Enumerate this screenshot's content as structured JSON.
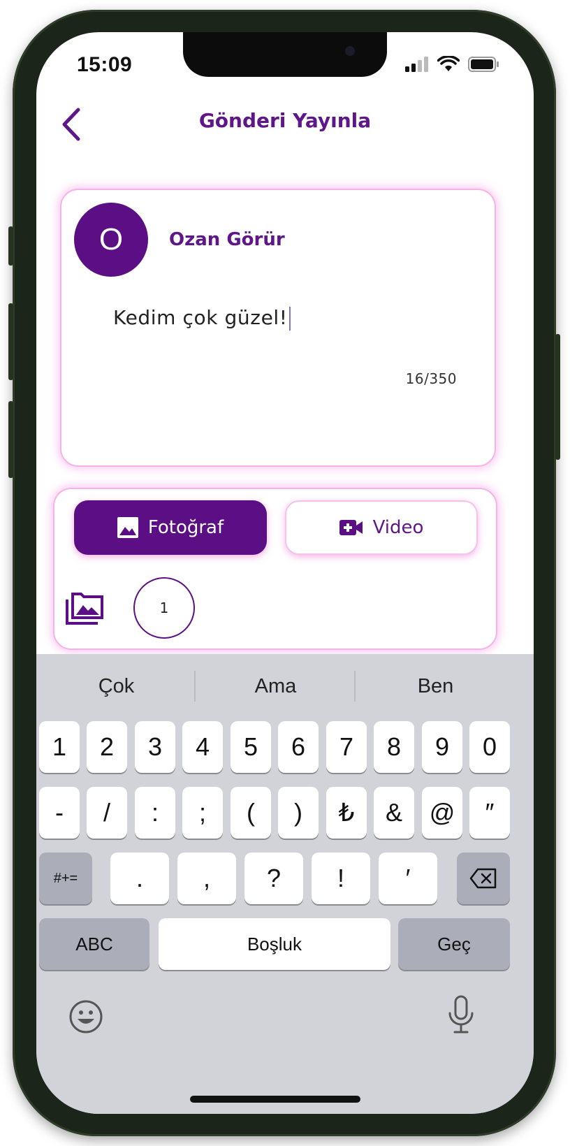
{
  "status_bar": {
    "time": "15:09"
  },
  "header": {
    "title": "Gönderi Yayınla"
  },
  "composer": {
    "avatar_initial": "O",
    "user_name": "Ozan Görür",
    "text": "Kedim çok güzel!",
    "char_counter": "16/350"
  },
  "media": {
    "tabs": [
      {
        "label": "Fotoğraf",
        "selected": true
      },
      {
        "label": "Video",
        "selected": false
      }
    ],
    "selected_count": "1"
  },
  "keyboard": {
    "suggestions": [
      "Çok",
      "Ama",
      "Ben"
    ],
    "row1": [
      "1",
      "2",
      "3",
      "4",
      "5",
      "6",
      "7",
      "8",
      "9",
      "0"
    ],
    "row2": [
      "-",
      "/",
      ":",
      ";",
      "(",
      ")",
      "₺",
      "&",
      "@",
      "″"
    ],
    "row3": [
      "#+=",
      ".",
      ",",
      "?",
      "!",
      "′"
    ],
    "abc_label": "ABC",
    "space_label": "Boşluk",
    "return_label": "Geç"
  },
  "colors": {
    "accent": "#5c0e85",
    "title": "#5e1688",
    "card_glow": "#f284de",
    "keyboard_bg": "#d1d3d9"
  }
}
